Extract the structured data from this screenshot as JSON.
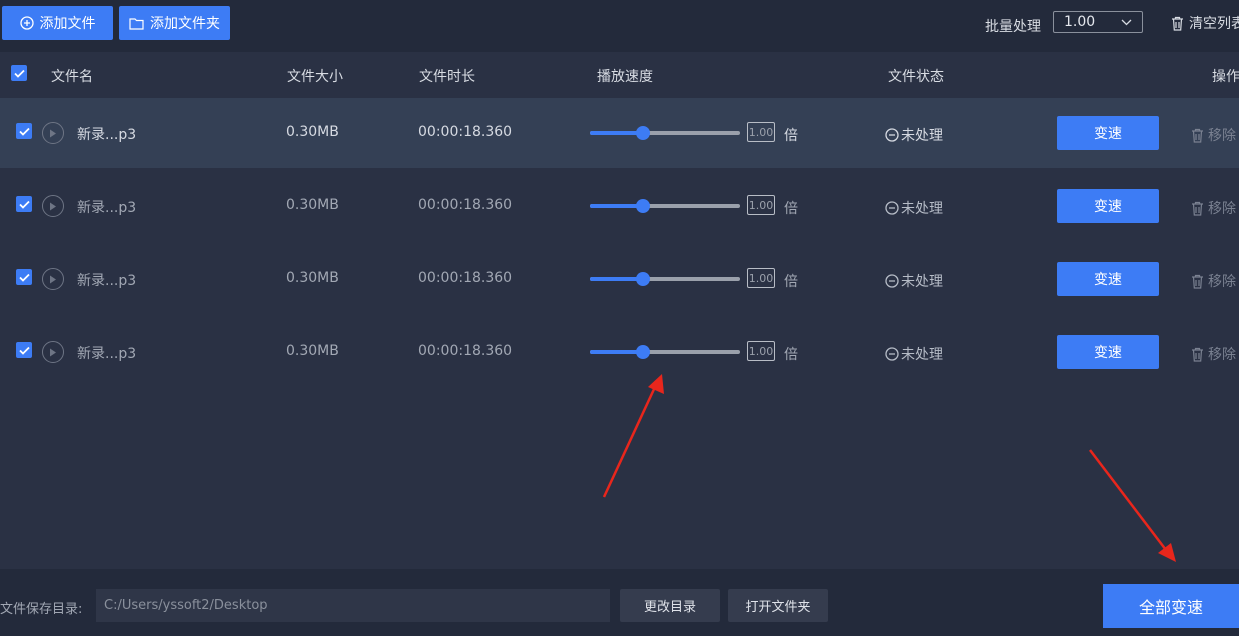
{
  "toolbar": {
    "add_file_label": "添加文件",
    "add_folder_label": "添加文件夹",
    "batch_label": "批量处理",
    "batch_value": "1.00",
    "clear_label": "清空列表"
  },
  "table": {
    "headers": {
      "name": "文件名",
      "size": "文件大小",
      "duration": "文件时长",
      "speed": "播放速度",
      "status": "文件状态",
      "action": "操作"
    },
    "rows": [
      {
        "name": "新录...p3",
        "size": "0.30MB",
        "duration": "00:00:18.360",
        "speed": "1.00",
        "unit": "倍",
        "status": "未处理",
        "action": "变速",
        "remove": "移除",
        "slider_level": 0.35
      },
      {
        "name": "新录...p3",
        "size": "0.30MB",
        "duration": "00:00:18.360",
        "speed": "1.00",
        "unit": "倍",
        "status": "未处理",
        "action": "变速",
        "remove": "移除",
        "slider_level": 0.35
      },
      {
        "name": "新录...p3",
        "size": "0.30MB",
        "duration": "00:00:18.360",
        "speed": "1.00",
        "unit": "倍",
        "status": "未处理",
        "action": "变速",
        "remove": "移除",
        "slider_level": 0.35
      },
      {
        "name": "新录...p3",
        "size": "0.30MB",
        "duration": "00:00:18.360",
        "speed": "1.00",
        "unit": "倍",
        "status": "未处理",
        "action": "变速",
        "remove": "移除",
        "slider_level": 0.35
      }
    ]
  },
  "footer": {
    "save_dir_label": "文件保存目录:",
    "save_dir_value": "C:/Users/yssoft2/Desktop",
    "change_dir_label": "更改目录",
    "open_folder_label": "打开文件夹",
    "process_all_label": "全部变速"
  },
  "colors": {
    "accent": "#3d7cf5",
    "annotation_arrow": "#e8261c"
  }
}
